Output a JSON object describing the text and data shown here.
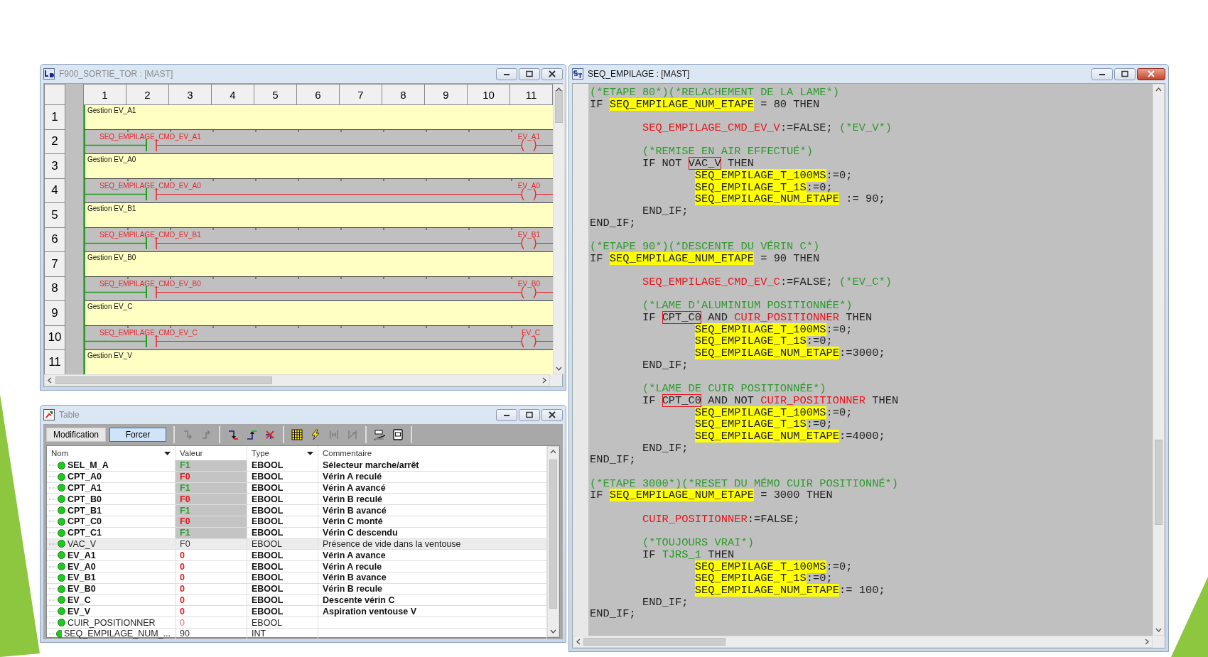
{
  "ladder_window": {
    "kind": "ladder",
    "title": "F900_SORTIE_TOR : [MAST]",
    "active": false,
    "columns": [
      "1",
      "2",
      "3",
      "4",
      "5",
      "6",
      "7",
      "8",
      "9",
      "10",
      "11"
    ],
    "rows": [
      {
        "number": "1",
        "kind": "comment",
        "text": "Gestion EV_A1"
      },
      {
        "number": "2",
        "kind": "rung",
        "contact": "SEQ_EMPILAGE_CMD_EV_A1",
        "coil": "EV_A1",
        "active": false
      },
      {
        "number": "3",
        "kind": "comment",
        "text": "Gestion EV_A0"
      },
      {
        "number": "4",
        "kind": "rung",
        "contact": "SEQ_EMPILAGE_CMD_EV_A0",
        "coil": "EV_A0",
        "active": false
      },
      {
        "number": "5",
        "kind": "comment",
        "text": "Gestion EV_B1"
      },
      {
        "number": "6",
        "kind": "rung",
        "contact": "SEQ_EMPILAGE_CMD_EV_B1",
        "coil": "EV_B1",
        "active": false
      },
      {
        "number": "7",
        "kind": "comment",
        "text": "Gestion EV_B0"
      },
      {
        "number": "8",
        "kind": "rung",
        "contact": "SEQ_EMPILAGE_CMD_EV_B0",
        "coil": "EV_B0",
        "active": false
      },
      {
        "number": "9",
        "kind": "comment",
        "text": "Gestion EV_C"
      },
      {
        "number": "10",
        "kind": "rung",
        "contact": "SEQ_EMPILAGE_CMD_EV_C",
        "coil": "EV_C",
        "active": false
      },
      {
        "number": "11",
        "kind": "comment",
        "text": "Gestion EV_V"
      }
    ]
  },
  "table_window": {
    "kind": "table",
    "title": "Table",
    "active": false,
    "modes": [
      {
        "label": "Modification",
        "selected": false
      },
      {
        "label": "Forcer",
        "selected": true
      }
    ],
    "tools": [
      {
        "disabled": true
      },
      {
        "disabled": true
      },
      {
        "disabled": false
      },
      {
        "disabled": false
      },
      {
        "disabled": false
      },
      {
        "disabled": false
      },
      {
        "disabled": false
      },
      {
        "disabled": true
      },
      {
        "disabled": true
      },
      {
        "disabled": false
      },
      {
        "disabled": false
      }
    ],
    "columns": [
      {
        "label": "Nom",
        "dropdown": true
      },
      {
        "label": "Valeur",
        "dropdown": false
      },
      {
        "label": "Type",
        "dropdown": true
      },
      {
        "label": "Commentaire",
        "dropdown": false
      }
    ],
    "rows": [
      {
        "name": "SEL_M_A",
        "value": "F1",
        "type": "EBOOL",
        "comment": "Sélecteur marche/arrêt",
        "emphasized": true,
        "forced": true,
        "color": "#2e9a2e",
        "selected": false
      },
      {
        "name": "CPT_A0",
        "value": "F0",
        "type": "EBOOL",
        "comment": "Vérin A reculé",
        "emphasized": true,
        "forced": true,
        "color": "#e8141c",
        "selected": false
      },
      {
        "name": "CPT_A1",
        "value": "F1",
        "type": "EBOOL",
        "comment": "Vérin A avancé",
        "emphasized": true,
        "forced": true,
        "color": "#2e9a2e",
        "selected": false
      },
      {
        "name": "CPT_B0",
        "value": "F0",
        "type": "EBOOL",
        "comment": "Vérin B reculé",
        "emphasized": true,
        "forced": true,
        "color": "#e8141c",
        "selected": false
      },
      {
        "name": "CPT_B1",
        "value": "F1",
        "type": "EBOOL",
        "comment": "Vérin B avancé",
        "emphasized": true,
        "forced": true,
        "color": "#2e9a2e",
        "selected": false
      },
      {
        "name": "CPT_C0",
        "value": "F0",
        "type": "EBOOL",
        "comment": "Vérin C monté",
        "emphasized": true,
        "forced": true,
        "color": "#e8141c",
        "selected": false
      },
      {
        "name": "CPT_C1",
        "value": "F1",
        "type": "EBOOL",
        "comment": "Vérin C descendu",
        "emphasized": true,
        "forced": true,
        "color": "#2e9a2e",
        "selected": false
      },
      {
        "name": "VAC_V",
        "value": "F0",
        "type": "EBOOL",
        "comment": "Présence de vide dans la ventouse",
        "emphasized": false,
        "forced": false,
        "color": "#333333",
        "selected": true
      },
      {
        "name": "EV_A1",
        "value": "0",
        "type": "EBOOL",
        "comment": "Vérin A avance",
        "emphasized": true,
        "forced": false,
        "color": "#e8141c",
        "selected": false
      },
      {
        "name": "EV_A0",
        "value": "0",
        "type": "EBOOL",
        "comment": "Vérin A recule",
        "emphasized": true,
        "forced": false,
        "color": "#e8141c",
        "selected": false
      },
      {
        "name": "EV_B1",
        "value": "0",
        "type": "EBOOL",
        "comment": "Vérin B avance",
        "emphasized": true,
        "forced": false,
        "color": "#e8141c",
        "selected": false
      },
      {
        "name": "EV_B0",
        "value": "0",
        "type": "EBOOL",
        "comment": "Vérin B recule",
        "emphasized": true,
        "forced": false,
        "color": "#e8141c",
        "selected": false
      },
      {
        "name": "EV_C",
        "value": "0",
        "type": "EBOOL",
        "comment": "Descente vérin C",
        "emphasized": true,
        "forced": false,
        "color": "#e8141c",
        "selected": false
      },
      {
        "name": "EV_V",
        "value": "0",
        "type": "EBOOL",
        "comment": "Aspiration ventouse V",
        "emphasized": true,
        "forced": false,
        "color": "#e8141c",
        "selected": false
      },
      {
        "name": "CUIR_POSITIONNER",
        "value": "0",
        "type": "EBOOL",
        "emphasized": false,
        "forced": false,
        "color": "#f06060",
        "selected": false
      },
      {
        "name": "SEQ_EMPILAGE_NUM_...",
        "value": "90",
        "type": "INT",
        "emphasized": false,
        "forced": false,
        "color": "#333333",
        "selected": false
      }
    ]
  },
  "code_window": {
    "kind": "code",
    "title": "SEQ_EMPILAGE : [MAST]",
    "active": true,
    "lines": [
      {
        "kind": "code",
        "tokens": [
          {
            "text": "(*ETAPE 80*)(*RELACHEMENT DE LA LAME*)",
            "kind": "comment"
          }
        ]
      },
      {
        "kind": "code",
        "tokens": [
          {
            "text": "IF ",
            "kind": "plain"
          },
          {
            "text": "SEQ_EMPILAGE_NUM_ETAPE",
            "kind": "highlight"
          },
          {
            "text": " = 80 THEN",
            "kind": "plain"
          }
        ],
        "children": [
          {
            "kind": "blank"
          },
          {
            "kind": "code",
            "tokens": [
              {
                "text": "SEQ_EMPILAGE_CMD_EV_V",
                "kind": "variable"
              },
              {
                "text": ":=FALSE; ",
                "kind": "plain"
              },
              {
                "text": "(*EV_V*)",
                "kind": "comment"
              }
            ]
          },
          {
            "kind": "blank"
          },
          {
            "kind": "code",
            "tokens": [
              {
                "text": "(*REMISE EN AIR EFFECTUÉ*)",
                "kind": "comment"
              }
            ]
          },
          {
            "kind": "code",
            "tokens": [
              {
                "text": "IF NOT ",
                "kind": "plain"
              },
              {
                "text": "VAC_V",
                "kind": "boxed"
              },
              {
                "text": " THEN",
                "kind": "plain"
              }
            ],
            "children": [
              {
                "kind": "code",
                "tokens": [
                  {
                    "text": "SEQ_EMPILAGE_T_100MS",
                    "kind": "highlight"
                  },
                  {
                    "text": ":=0;",
                    "kind": "plain"
                  }
                ]
              },
              {
                "kind": "code",
                "tokens": [
                  {
                    "text": "SEQ_EMPILAGE_T_1S",
                    "kind": "highlight"
                  },
                  {
                    "text": ":=0;",
                    "kind": "plain"
                  }
                ]
              },
              {
                "kind": "code",
                "tokens": [
                  {
                    "text": "SEQ_EMPILAGE_NUM_ETAPE",
                    "kind": "highlight"
                  },
                  {
                    "text": " := 90;",
                    "kind": "plain"
                  }
                ]
              }
            ]
          },
          {
            "kind": "code",
            "tokens": [
              {
                "text": "END_IF;",
                "kind": "plain"
              }
            ]
          }
        ]
      },
      {
        "kind": "code",
        "tokens": [
          {
            "text": "END_IF;",
            "kind": "plain"
          }
        ]
      },
      {
        "kind": "blank"
      },
      {
        "kind": "code",
        "tokens": [
          {
            "text": "(*ETAPE 90*)(*DESCENTE DU VÉRIN C*)",
            "kind": "comment"
          }
        ]
      },
      {
        "kind": "code",
        "tokens": [
          {
            "text": "IF ",
            "kind": "plain"
          },
          {
            "text": "SEQ_EMPILAGE_NUM_ETAPE",
            "kind": "highlight"
          },
          {
            "text": " = 90 THEN",
            "kind": "plain"
          }
        ],
        "children": [
          {
            "kind": "blank"
          },
          {
            "kind": "code",
            "tokens": [
              {
                "text": "SEQ_EMPILAGE_CMD_EV_C",
                "kind": "variable"
              },
              {
                "text": ":=FALSE; ",
                "kind": "plain"
              },
              {
                "text": "(*EV_C*)",
                "kind": "comment"
              }
            ]
          },
          {
            "kind": "blank"
          },
          {
            "kind": "code",
            "tokens": [
              {
                "text": "(*LAME D'ALUMINIUM POSITIONNÉE*)",
                "kind": "comment"
              }
            ]
          },
          {
            "kind": "code",
            "tokens": [
              {
                "text": "IF ",
                "kind": "plain"
              },
              {
                "text": "CPT_C0",
                "kind": "boxed"
              },
              {
                "text": " AND ",
                "kind": "plain"
              },
              {
                "text": "CUIR_POSITIONNER",
                "kind": "variable"
              },
              {
                "text": " THEN",
                "kind": "plain"
              }
            ],
            "children": [
              {
                "kind": "code",
                "tokens": [
                  {
                    "text": "SEQ_EMPILAGE_T_100MS",
                    "kind": "highlight"
                  },
                  {
                    "text": ":=0;",
                    "kind": "plain"
                  }
                ]
              },
              {
                "kind": "code",
                "tokens": [
                  {
                    "text": "SEQ_EMPILAGE_T_1S",
                    "kind": "highlight"
                  },
                  {
                    "text": ":=0;",
                    "kind": "plain"
                  }
                ]
              },
              {
                "kind": "code",
                "tokens": [
                  {
                    "text": "SEQ_EMPILAGE_NUM_ETAPE",
                    "kind": "highlight"
                  },
                  {
                    "text": ":=3000;",
                    "kind": "plain"
                  }
                ]
              }
            ]
          },
          {
            "kind": "code",
            "tokens": [
              {
                "text": "END_IF;",
                "kind": "plain"
              }
            ]
          },
          {
            "kind": "blank"
          },
          {
            "kind": "code",
            "tokens": [
              {
                "text": "(*LAME DE CUIR POSITIONNÉE*)",
                "kind": "comment"
              }
            ]
          },
          {
            "kind": "code",
            "tokens": [
              {
                "text": "IF ",
                "kind": "plain"
              },
              {
                "text": "CPT_C0",
                "kind": "boxed"
              },
              {
                "text": " AND NOT ",
                "kind": "plain"
              },
              {
                "text": "CUIR_POSITIONNER",
                "kind": "variable"
              },
              {
                "text": " THEN",
                "kind": "plain"
              }
            ],
            "children": [
              {
                "kind": "code",
                "tokens": [
                  {
                    "text": "SEQ_EMPILAGE_T_100MS",
                    "kind": "highlight"
                  },
                  {
                    "text": ":=0;",
                    "kind": "plain"
                  }
                ]
              },
              {
                "kind": "code",
                "tokens": [
                  {
                    "text": "SEQ_EMPILAGE_T_1S",
                    "kind": "highlight"
                  },
                  {
                    "text": ":=0;",
                    "kind": "plain"
                  }
                ]
              },
              {
                "kind": "code",
                "tokens": [
                  {
                    "text": "SEQ_EMPILAGE_NUM_ETAPE",
                    "kind": "highlight"
                  },
                  {
                    "text": ":=4000;",
                    "kind": "plain"
                  }
                ]
              }
            ]
          },
          {
            "kind": "code",
            "tokens": [
              {
                "text": "END_IF;",
                "kind": "plain"
              }
            ]
          }
        ]
      },
      {
        "kind": "code",
        "tokens": [
          {
            "text": "END_IF;",
            "kind": "plain"
          }
        ]
      },
      {
        "kind": "blank"
      },
      {
        "kind": "code",
        "tokens": [
          {
            "text": "(*ETAPE 3000*)(*RESET DU MÉMO CUIR POSITIONNÉ*)",
            "kind": "comment"
          }
        ]
      },
      {
        "kind": "code",
        "tokens": [
          {
            "text": "IF ",
            "kind": "plain"
          },
          {
            "text": "SEQ_EMPILAGE_NUM_ETAPE",
            "kind": "highlight"
          },
          {
            "text": " = 3000 THEN",
            "kind": "plain"
          }
        ],
        "children": [
          {
            "kind": "blank"
          },
          {
            "kind": "code",
            "tokens": [
              {
                "text": "CUIR_POSITIONNER",
                "kind": "variable"
              },
              {
                "text": ":=FALSE;",
                "kind": "plain"
              }
            ]
          },
          {
            "kind": "blank"
          },
          {
            "kind": "code",
            "tokens": [
              {
                "text": "(*TOUJOURS VRAI*)",
                "kind": "comment"
              }
            ]
          },
          {
            "kind": "code",
            "tokens": [
              {
                "text": "IF ",
                "kind": "plain"
              },
              {
                "text": "TJRS_1",
                "kind": "constant"
              },
              {
                "text": " THEN",
                "kind": "plain"
              }
            ],
            "children": [
              {
                "kind": "code",
                "tokens": [
                  {
                    "text": "SEQ_EMPILAGE_T_100MS",
                    "kind": "highlight"
                  },
                  {
                    "text": ":=0;",
                    "kind": "plain"
                  }
                ]
              },
              {
                "kind": "code",
                "tokens": [
                  {
                    "text": "SEQ_EMPILAGE_T_1S",
                    "kind": "highlight"
                  },
                  {
                    "text": ":=0;",
                    "kind": "plain"
                  }
                ]
              },
              {
                "kind": "code",
                "tokens": [
                  {
                    "text": "SEQ_EMPILAGE_NUM_ETAPE",
                    "kind": "highlight"
                  },
                  {
                    "text": ":= 100;",
                    "kind": "plain"
                  }
                ]
              }
            ]
          },
          {
            "kind": "code",
            "tokens": [
              {
                "text": "END_IF;",
                "kind": "plain"
              }
            ]
          }
        ]
      },
      {
        "kind": "code",
        "tokens": [
          {
            "text": "END_IF;",
            "kind": "plain"
          }
        ]
      }
    ]
  }
}
